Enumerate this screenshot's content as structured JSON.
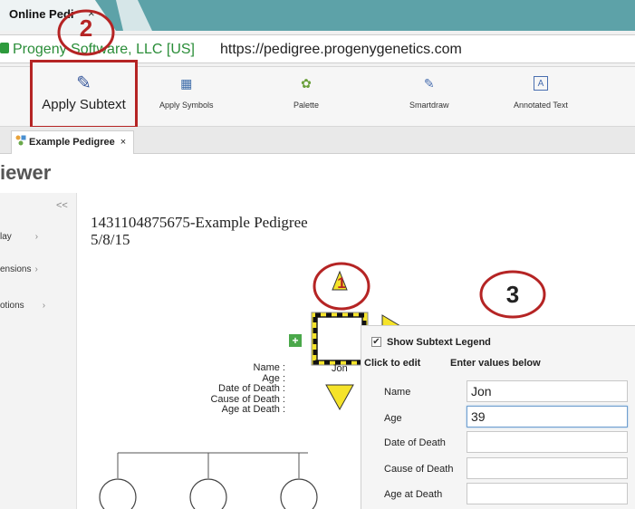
{
  "browser": {
    "tab_title": "Online Pedi",
    "tab_close": "×",
    "identity": "Progeny Software, LLC [US]",
    "url": "https://pedigree.progenygenetics.com"
  },
  "ribbon": {
    "apply_subtext": "Apply Subtext",
    "apply_symbols": "Apply Symbols",
    "palette": "Palette",
    "smartdraw": "Smartdraw",
    "annotated_text": "Annotated Text"
  },
  "doc_tab": {
    "label": "Example Pedigree",
    "close": "×"
  },
  "viewer": {
    "title": "iewer",
    "collapse": "<<",
    "items": [
      "lay",
      "ensions",
      "otions"
    ],
    "chevron": "›"
  },
  "pedigree": {
    "title": "1431104875675-Example Pedigree",
    "date": "5/8/15",
    "add_button": "+",
    "subtext_labels": [
      "Name :",
      "Age :",
      "Date of Death :",
      "Cause of Death :",
      "Age at Death :"
    ],
    "name_value": "Jon"
  },
  "legend_panel": {
    "show_legend_label": "Show Subtext Legend",
    "show_legend_checked": "✔",
    "click_hint": "Click to edit",
    "values_hint": "Enter values below",
    "fields": [
      {
        "label": "Name",
        "value": "Jon"
      },
      {
        "label": "Age",
        "value": "39"
      },
      {
        "label": "Date of Death",
        "value": ""
      },
      {
        "label": "Cause of Death",
        "value": ""
      },
      {
        "label": "Age at Death",
        "value": ""
      }
    ]
  },
  "callouts": {
    "step1": "1",
    "step2": "2",
    "step3": "3"
  },
  "colors": {
    "callout_red": "#b52424",
    "symbol_yellow": "#f5e32a",
    "tab_teal": "#5da2a8",
    "identity_green": "#2a8d38"
  }
}
